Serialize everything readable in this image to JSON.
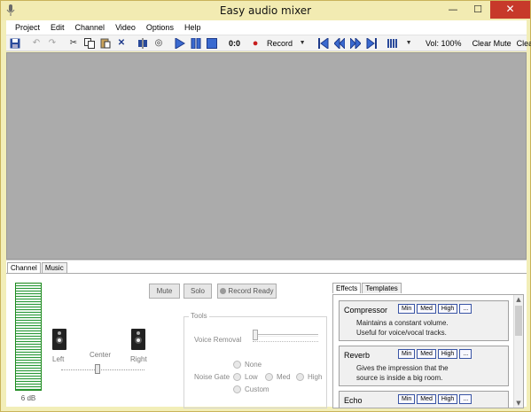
{
  "window": {
    "title": "Easy audio mixer",
    "minimize": "—",
    "maximize": "☐",
    "close": "✕"
  },
  "menu": [
    "Project",
    "Edit",
    "Channel",
    "Video",
    "Options",
    "Help"
  ],
  "toolbar": {
    "counter": "0:0",
    "record_label": "Record",
    "volume": "Vol: 100%",
    "clear_mute": "Clear Mute",
    "clear_solo": "Clear Solo"
  },
  "bottom_tabs": [
    "Channel",
    "Music"
  ],
  "channel": {
    "meter_label": "6 dB",
    "left_label": "Left",
    "center_label": "Center",
    "right_label": "Right",
    "mute_label": "Mute",
    "solo_label": "Solo",
    "record_ready_label": "Record Ready"
  },
  "tools": {
    "legend": "Tools",
    "voice_removal_label": "Voice Removal",
    "noise_gate_label": "Noise Gate",
    "noise_gate_options": [
      "None",
      "Low",
      "Med",
      "High",
      "Custom"
    ]
  },
  "effects": {
    "tabs": [
      "Effects",
      "Templates"
    ],
    "preset_buttons": [
      "Min",
      "Med",
      "High",
      "..."
    ],
    "items": [
      {
        "name": "Compressor",
        "desc_line1": "Maintains a constant volume.",
        "desc_line2": "Useful for voice/vocal tracks."
      },
      {
        "name": "Reverb",
        "desc_line1": "Gives the impression that the",
        "desc_line2": "source is inside a big room."
      },
      {
        "name": "Echo",
        "desc_line1": "",
        "desc_line2": ""
      }
    ]
  },
  "colors": {
    "meter_green": "#2a9a3a",
    "close_red": "#c7392a",
    "record_red": "#c71e1e"
  }
}
